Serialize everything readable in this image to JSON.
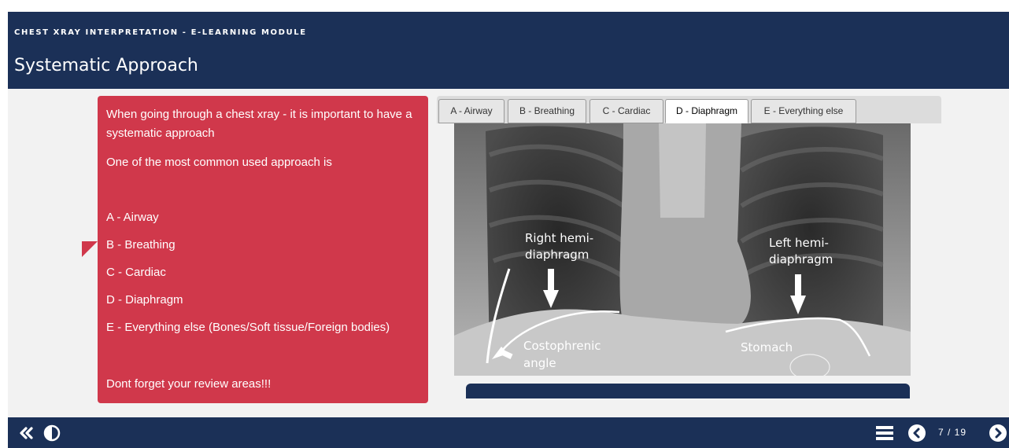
{
  "header": {
    "course_title": "CHEST XRAY INTERPRETATION - E-LEARNING MODULE",
    "page_title": "Systematic Approach"
  },
  "callout": {
    "intro": "When going through a chest xray - it is important  to have a systematic approach",
    "approach": "One of the most common used approach is",
    "items": [
      "A - Airway",
      "B - Breathing",
      "C - Cardiac",
      "D - Diaphragm",
      "E - Everything else (Bones/Soft tissue/Foreign bodies)"
    ],
    "review": "Dont forget your review areas!!!"
  },
  "tabs": [
    {
      "label": "A - Airway",
      "active": false
    },
    {
      "label": "B - Breathing",
      "active": false
    },
    {
      "label": "C - Cardiac",
      "active": false
    },
    {
      "label": "D - Diaphragm",
      "active": true
    },
    {
      "label": "E - Everything else",
      "active": false
    }
  ],
  "xray": {
    "label_right": "Right hemi-",
    "label_right2": "diaphragm",
    "label_left": "Left hemi-",
    "label_left2": "diaphragm",
    "label_angle": "Costophrenic",
    "label_angle2": "angle",
    "label_stomach": "Stomach"
  },
  "footer": {
    "page_counter": "7 / 19",
    "icons": [
      "double-chevron-left-icon",
      "contrast-icon",
      "menu-icon",
      "chevron-left-circle-icon",
      "chevron-right-circle-icon"
    ]
  },
  "colors": {
    "navy": "#1b3057",
    "callout_red": "#d0384b",
    "content_bg": "#f2f2f2"
  }
}
